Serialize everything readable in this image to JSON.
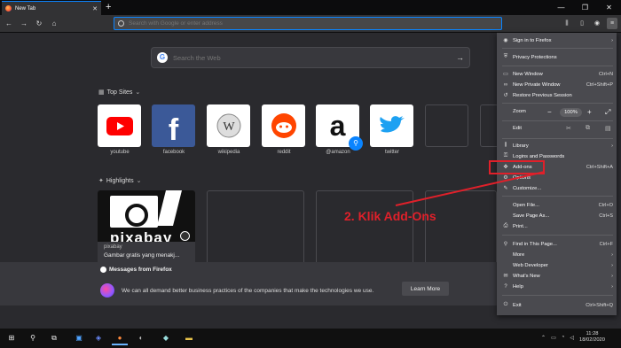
{
  "browser": {
    "tab_title": "New Tab",
    "new_tab_symbol": "+",
    "url_placeholder": "Search with Google or enter address"
  },
  "newtab": {
    "search_placeholder": "Search the Web",
    "top_sites_label": "Top Sites",
    "highlights_label": "Highlights",
    "top_sites": [
      {
        "label": "youtube"
      },
      {
        "label": "facebook"
      },
      {
        "label": "wikipedia"
      },
      {
        "label": "reddit"
      },
      {
        "label": "@amazon"
      },
      {
        "label": "twitter"
      }
    ],
    "highlight": {
      "source": "pixabay",
      "title": "Gambar gratis yang menakj...",
      "image_word": "pixabay"
    },
    "messages": {
      "heading": "Messages from Firefox",
      "body": "We can all demand better business practices of the companies that make the technologies we use.",
      "button": "Learn More"
    }
  },
  "menu": {
    "sign_in": "Sign in to Firefox",
    "privacy": "Privacy Protections",
    "new_window": {
      "label": "New Window",
      "shortcut": "Ctrl+N"
    },
    "new_private": {
      "label": "New Private Window",
      "shortcut": "Ctrl+Shift+P"
    },
    "restore": "Restore Previous Session",
    "zoom_label": "Zoom",
    "zoom_value": "100%",
    "edit_label": "Edit",
    "library": "Library",
    "logins": "Logins and Passwords",
    "addons": {
      "label": "Add-ons",
      "shortcut": "Ctrl+Shift+A"
    },
    "options": "Options",
    "customize": "Customize...",
    "open_file": {
      "label": "Open File...",
      "shortcut": "Ctrl+O"
    },
    "save_page": {
      "label": "Save Page As...",
      "shortcut": "Ctrl+S"
    },
    "print": "Print...",
    "find": {
      "label": "Find in This Page...",
      "shortcut": "Ctrl+F"
    },
    "more": "More",
    "web_dev": "Web Developer",
    "whats_new": "What's New",
    "help": "Help",
    "exit": {
      "label": "Exit",
      "shortcut": "Ctrl+Shift+Q"
    }
  },
  "annotation": {
    "text": "2. Klik Add-Ons",
    "color": "#e0202a"
  },
  "taskbar": {
    "time": "11:28",
    "date": "18/02/2020"
  }
}
